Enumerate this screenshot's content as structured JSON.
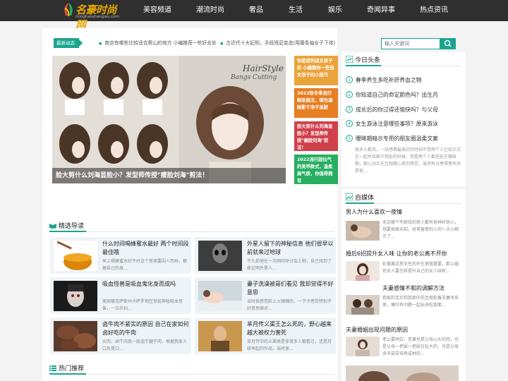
{
  "site": {
    "logo_text": "名豪时尚网",
    "logo_sub": "minghaoshangwu.com"
  },
  "nav": [
    "美容频道",
    "潮流时尚",
    "奢品",
    "生活",
    "娱乐",
    "奇闻异事",
    "热点资讯"
  ],
  "ticker": {
    "badge": "最新动态",
    "items": [
      "南京有哪些比较适合爬山的地方 小编推荐一些好去处",
      "古近代十大妃刑，手段残忍变态(用藤条抽女子下体)"
    ]
  },
  "hero": {
    "caption": "脸大剪什么刘海显脸小？发型师传授\"瘦脸刘海\"剪法！",
    "art_title": "HairStyle",
    "art_sub": "Bangs Cutting"
  },
  "side_promos": [
    {
      "text": "你是如何追女孩子的 小编教你一些追女孩子的小技巧",
      "color": "#e9a43b"
    },
    {
      "text": "2022秋冬季流行眼妆画法，堪色调眼影千净不显脏",
      "color": "#e67e22"
    },
    {
      "text": "脸大剪什么刘海显脸小？发型师传授\"瘦脸刘海\"剪法！",
      "color": "#d0404a"
    },
    {
      "text": "2022流行超仙气的美甲款式，温柔高气质，你值得拥有",
      "color": "#27ae60"
    }
  ],
  "featured": {
    "title": "精选导读",
    "articles": [
      {
        "title": "什么时间喝蜂蜜水最好 两个时间段最佳哦",
        "desc": "早上喝蜂蜜水好不好这个答案要因人而异，根据自己的身..."
      },
      {
        "title": "外星人留下的神秘信息 他们很早以前就来过地球",
        "desc": "不久前地在一次国际研讨会上称，自己找到了能证明外星人..."
      },
      {
        "title": "吸血怪兽是吸血鬼化身而成吗",
        "desc": "美国德克萨斯州卡萨罗地区惊现神秘吸血怪兽，一位农妇..."
      },
      {
        "title": "妻子洗澡被哥们看见 我却觉得不好意思",
        "desc": "当时我感觉脸上火辣辣的，一下子感觉特别不好意思面对..."
      },
      {
        "title": "卤牛肉不紧实的原因 自己在家如何卤好吃的牛肉",
        "desc": "买肉，卤牛肉我一般选牛腱子肉，根据我家人口及胃口..."
      },
      {
        "title": "芈月传义渠王怎么死的，野心越来越大被权力害死",
        "desc": "芈月传中的义渠君是非常多人都看过，还是持续早起的作品，当时享..."
      }
    ]
  },
  "hot": {
    "title": "热门推荐"
  },
  "search": {
    "placeholder": "输入关键词"
  },
  "headlines": {
    "title": "今日头条",
    "items": [
      "春季养生多吃补肝养血之物",
      "你知道自己的命定颜色吗？出生月",
      "成长后的你过得还愉快吗？与父母",
      "女生游泳注意哪些事项？原来游泳",
      "暧昧期暗示专用的朋友圈温柔文案"
    ],
    "quote": "很多人都说，一段感情最美好的时刻不是两个人已经正式在一起并且朝夕相处的时候，而是两个人都还处在暧昧期，那心动又在互相猜心思的感觉，虽然有点患得患失但是很..."
  },
  "media": {
    "title": "自媒体",
    "items": [
      {
        "title": "男人为什么喜欢一夜情",
        "desc": "无论哪个年龄段的男人都有各种好奇心，想要探索未知，经常留意别人的一点小暗示了..."
      },
      {
        "title": "婚后6招提升女人味 让你的老公离不开你",
        "desc": "彩蛋酱这里女生的外在美很重要，那么婚后女人要怎样提升自己的女人味呢..."
      },
      {
        "title": "夫妻感情不和的调解方法",
        "desc": "我家的宝贝和我家的先生相处着夫妻关系差，偶尔有问题一起出去吃饭面..."
      },
      {
        "title": "夫妻婚姻出现问题的原因",
        "desc": "老公要明白：老婆也是父母心头的肉，也是父母一把屎一把尿拉扯大的，也是父母含辛茹苦培养成材的..."
      }
    ]
  },
  "colors": {
    "accent": "#1aa590",
    "nav_bg": "#2f2f2f"
  }
}
